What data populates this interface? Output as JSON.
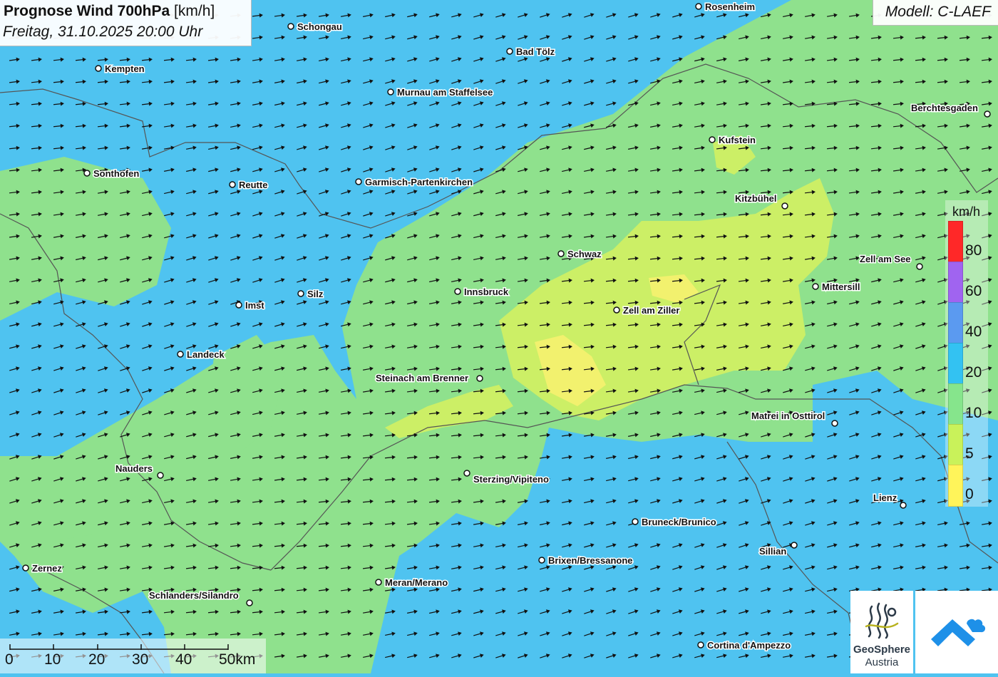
{
  "header": {
    "title_bold": "Prognose Wind 700hPa",
    "title_unit": "[km/h]",
    "subtitle": "Freitag, 31.10.2025 20:00 Uhr"
  },
  "model": {
    "label": "Modell: C-LAEF"
  },
  "legend": {
    "unit": "km/h",
    "labels": [
      "80",
      "60",
      "40",
      "20",
      "10",
      "5",
      "0"
    ],
    "colors": [
      "#ff2828",
      "#a064f0",
      "#5b9af0",
      "#33c2f2",
      "#86e58c",
      "#c9f25a",
      "#fff45a"
    ]
  },
  "scalebar": {
    "labels": [
      "0",
      "10",
      "20",
      "30",
      "40",
      "50km"
    ]
  },
  "logo": {
    "name_line1": "GeoSphere",
    "name_line2": "Austria"
  },
  "cities": [
    {
      "name": "Rosenheim"
    },
    {
      "name": "Schongau"
    },
    {
      "name": "Bad Tölz"
    },
    {
      "name": "Kempten"
    },
    {
      "name": "Murnau am Staffelsee"
    },
    {
      "name": "Berchtesgaden"
    },
    {
      "name": "Kufstein"
    },
    {
      "name": "Sonthofen"
    },
    {
      "name": "Reutte"
    },
    {
      "name": "Garmisch-Partenkirchen"
    },
    {
      "name": "Kitzbühel"
    },
    {
      "name": "Schwaz"
    },
    {
      "name": "Zell am See"
    },
    {
      "name": "Mittersill"
    },
    {
      "name": "Innsbruck"
    },
    {
      "name": "Silz"
    },
    {
      "name": "Imst"
    },
    {
      "name": "Zell am Ziller"
    },
    {
      "name": "Landeck"
    },
    {
      "name": "Steinach am Brenner"
    },
    {
      "name": "Matrei in Osttirol"
    },
    {
      "name": "Nauders"
    },
    {
      "name": "Sterzing/Vipiteno"
    },
    {
      "name": "Lienz"
    },
    {
      "name": "Bruneck/Brunico"
    },
    {
      "name": "Sillian"
    },
    {
      "name": "Brixen/Bressanone"
    },
    {
      "name": "Zernez"
    },
    {
      "name": "Meran/Merano"
    },
    {
      "name": "Schlanders/Silandro"
    },
    {
      "name": "Cortina d'Ampezzo"
    }
  ]
}
